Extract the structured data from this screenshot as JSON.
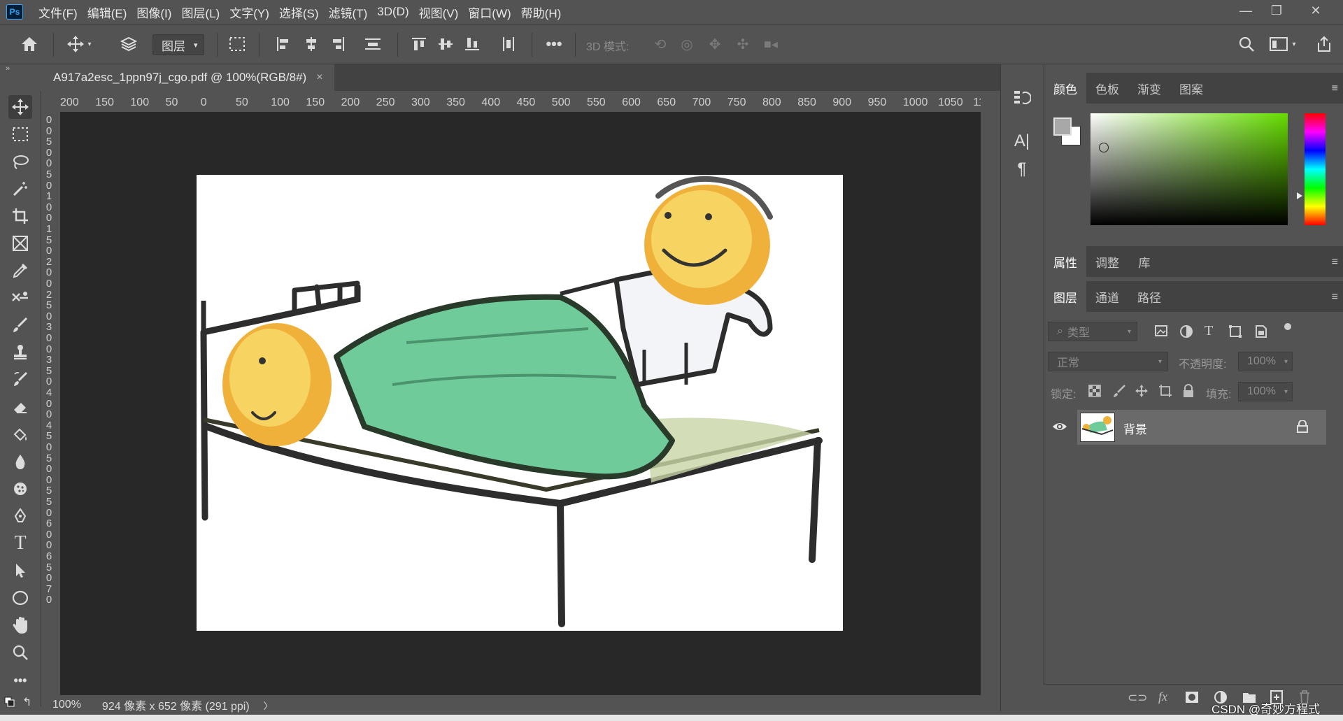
{
  "app": {
    "logo": "Ps"
  },
  "menu": [
    "文件(F)",
    "编辑(E)",
    "图像(I)",
    "图层(L)",
    "文字(Y)",
    "选择(S)",
    "滤镜(T)",
    "3D(D)",
    "视图(V)",
    "窗口(W)",
    "帮助(H)"
  ],
  "options_bar": {
    "auto_select_target": "图层",
    "mode_3d_label": "3D 模式:"
  },
  "document": {
    "tab_title": "A917a2esc_1ppn97j_cgo.pdf @ 100%(RGB/8#)",
    "close_glyph": "×"
  },
  "ruler": {
    "horizontal_labels": [
      "200",
      "150",
      "100",
      "50",
      "0",
      "50",
      "100",
      "150",
      "200",
      "250",
      "300",
      "350",
      "400",
      "450",
      "500",
      "550",
      "600",
      "650",
      "700",
      "750",
      "800",
      "850",
      "900",
      "950",
      "1000",
      "1050",
      "11"
    ],
    "vertical_labels": [
      "0",
      "0",
      "5",
      "0",
      "0",
      "5",
      "0",
      "1",
      "0",
      "0",
      "1",
      "5",
      "0",
      "2",
      "0",
      "0",
      "2",
      "5",
      "0",
      "3",
      "0",
      "0",
      "3",
      "5",
      "0",
      "4",
      "0",
      "0",
      "4",
      "5",
      "0",
      "5",
      "0",
      "0",
      "5",
      "5",
      "0",
      "6",
      "0",
      "0",
      "6",
      "5",
      "0",
      "7",
      "0"
    ]
  },
  "status": {
    "zoom": "100%",
    "doc_info": "924 像素 x 652 像素 (291 ppi)",
    "arrow": "〉"
  },
  "panels": {
    "color_tabs": [
      "颜色",
      "色板",
      "渐变",
      "图案"
    ],
    "properties_tabs": [
      "属性",
      "调整",
      "库"
    ],
    "layers_tabs": [
      "图层",
      "通道",
      "路径"
    ],
    "filter_kind": "类型",
    "blend_mode": "正常",
    "opacity_label": "不透明度:",
    "opacity_value": "100%",
    "lock_label": "锁定:",
    "fill_label": "填充:",
    "fill_value": "100%",
    "layers": [
      {
        "name": "背景",
        "visible": true,
        "locked": true
      }
    ]
  },
  "watermark": "CSDN @奇妙方程式",
  "colors": {
    "foreground": "#a8a8a8",
    "background": "#ffffff",
    "accent_green": "#66dd00"
  }
}
